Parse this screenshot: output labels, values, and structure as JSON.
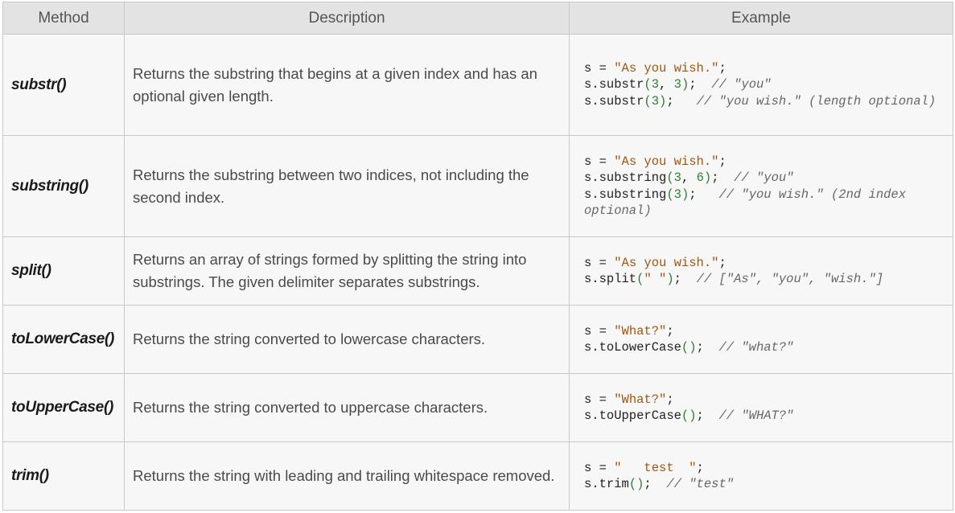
{
  "headers": {
    "method": "Method",
    "description": "Description",
    "example": "Example"
  },
  "colors": {
    "string": "#a0560f",
    "number": "#2e7d32",
    "comment": "#666666",
    "header_bg": "#e3e3e3",
    "cell_bg": "#f7f7f7"
  },
  "rows": [
    {
      "method": "substr()",
      "description": "Returns the substring that begins at a given index and has an optional given length.",
      "code": [
        [
          {
            "t": "s = ",
            "c": ""
          },
          {
            "t": "\"As you wish.\"",
            "c": "str"
          },
          {
            "t": ";",
            "c": ""
          }
        ],
        [
          {
            "t": "s.substr",
            "c": ""
          },
          {
            "t": "(",
            "c": "pl"
          },
          {
            "t": "3",
            "c": "num"
          },
          {
            "t": ", ",
            "c": ""
          },
          {
            "t": "3",
            "c": "num"
          },
          {
            "t": ")",
            "c": "pl"
          },
          {
            "t": ";  ",
            "c": ""
          },
          {
            "t": "// \"you\"",
            "c": "cm"
          }
        ],
        [
          {
            "t": "s.substr",
            "c": ""
          },
          {
            "t": "(",
            "c": "pl"
          },
          {
            "t": "3",
            "c": "num"
          },
          {
            "t": ")",
            "c": "pl"
          },
          {
            "t": ";   ",
            "c": ""
          },
          {
            "t": "// \"you wish.\" (length optional)",
            "c": "cm"
          }
        ]
      ]
    },
    {
      "method": "substring()",
      "description": "Returns the substring between two indices, not including the second index.",
      "code": [
        [
          {
            "t": "s = ",
            "c": ""
          },
          {
            "t": "\"As you wish.\"",
            "c": "str"
          },
          {
            "t": ";",
            "c": ""
          }
        ],
        [
          {
            "t": "s.substring",
            "c": ""
          },
          {
            "t": "(",
            "c": "pl"
          },
          {
            "t": "3",
            "c": "num"
          },
          {
            "t": ", ",
            "c": ""
          },
          {
            "t": "6",
            "c": "num"
          },
          {
            "t": ")",
            "c": "pl"
          },
          {
            "t": ";  ",
            "c": ""
          },
          {
            "t": "// \"you\"",
            "c": "cm"
          }
        ],
        [
          {
            "t": "s.substring",
            "c": ""
          },
          {
            "t": "(",
            "c": "pl"
          },
          {
            "t": "3",
            "c": "num"
          },
          {
            "t": ")",
            "c": "pl"
          },
          {
            "t": ";   ",
            "c": ""
          },
          {
            "t": "// \"you wish.\" (2nd index optional)",
            "c": "cm"
          }
        ]
      ]
    },
    {
      "method": "split()",
      "description": "Returns an array of strings formed by splitting the string into substrings. The given delimiter separates substrings.",
      "code": [
        [
          {
            "t": "s = ",
            "c": ""
          },
          {
            "t": "\"As you wish.\"",
            "c": "str"
          },
          {
            "t": ";",
            "c": ""
          }
        ],
        [
          {
            "t": "s.split",
            "c": ""
          },
          {
            "t": "(",
            "c": "pl"
          },
          {
            "t": "\" \"",
            "c": "str"
          },
          {
            "t": ")",
            "c": "pl"
          },
          {
            "t": ";  ",
            "c": ""
          },
          {
            "t": "// [\"As\", \"you\", \"wish.\"]",
            "c": "cm"
          }
        ]
      ]
    },
    {
      "method": "toLowerCase()",
      "description": "Returns the string converted to lowercase characters.",
      "code": [
        [
          {
            "t": "s = ",
            "c": ""
          },
          {
            "t": "\"What?\"",
            "c": "str"
          },
          {
            "t": ";",
            "c": ""
          }
        ],
        [
          {
            "t": "s.toLowerCase",
            "c": ""
          },
          {
            "t": "()",
            "c": "pl"
          },
          {
            "t": ";  ",
            "c": ""
          },
          {
            "t": "// \"what?\"",
            "c": "cm"
          }
        ]
      ]
    },
    {
      "method": "toUpperCase()",
      "description": "Returns the string converted to uppercase characters.",
      "code": [
        [
          {
            "t": "s = ",
            "c": ""
          },
          {
            "t": "\"What?\"",
            "c": "str"
          },
          {
            "t": ";",
            "c": ""
          }
        ],
        [
          {
            "t": "s.toUpperCase",
            "c": ""
          },
          {
            "t": "()",
            "c": "pl"
          },
          {
            "t": ";  ",
            "c": ""
          },
          {
            "t": "// \"WHAT?\"",
            "c": "cm"
          }
        ]
      ]
    },
    {
      "method": "trim()",
      "description": "Returns the string with leading and trailing whitespace removed.",
      "code": [
        [
          {
            "t": "s = ",
            "c": ""
          },
          {
            "t": "\"   test  \"",
            "c": "str"
          },
          {
            "t": ";",
            "c": ""
          }
        ],
        [
          {
            "t": "s.trim",
            "c": ""
          },
          {
            "t": "()",
            "c": "pl"
          },
          {
            "t": ";  ",
            "c": ""
          },
          {
            "t": "// \"test\"",
            "c": "cm"
          }
        ]
      ]
    }
  ]
}
